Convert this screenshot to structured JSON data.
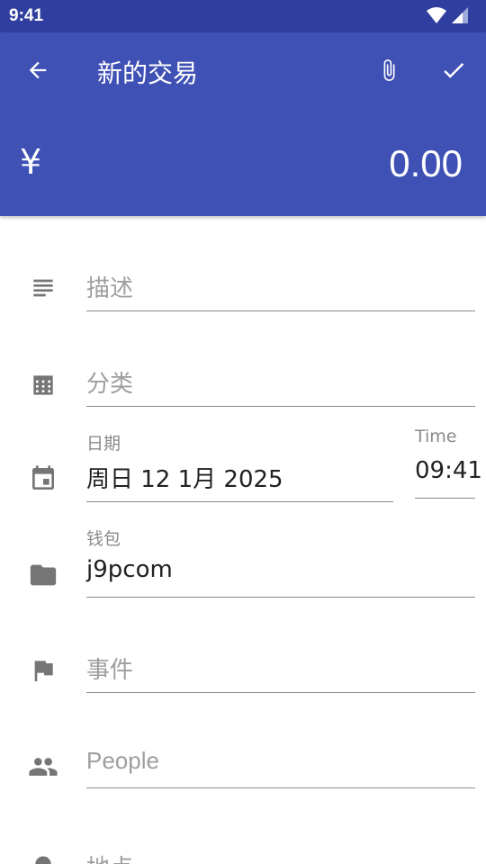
{
  "status_bar": {
    "time": "9:41"
  },
  "app_bar": {
    "title": "新的交易",
    "currency_symbol": "¥",
    "amount": "0.00",
    "color": "#3f51b5",
    "status_color": "#303f9f"
  },
  "form": {
    "description": {
      "placeholder": "描述",
      "icon": "notes-icon"
    },
    "category": {
      "placeholder": "分类",
      "icon": "grid-icon"
    },
    "date": {
      "label": "日期",
      "value": "周日 12 1月 2025",
      "icon": "calendar-icon"
    },
    "time": {
      "label": "Time",
      "value": "09:41"
    },
    "wallet": {
      "label": "钱包",
      "value": "j9pcom",
      "icon": "folder-icon"
    },
    "event": {
      "placeholder": "事件",
      "icon": "flag-icon"
    },
    "people": {
      "placeholder": "People",
      "icon": "people-icon"
    },
    "location": {
      "placeholder": "地点",
      "icon": "location-icon"
    }
  }
}
